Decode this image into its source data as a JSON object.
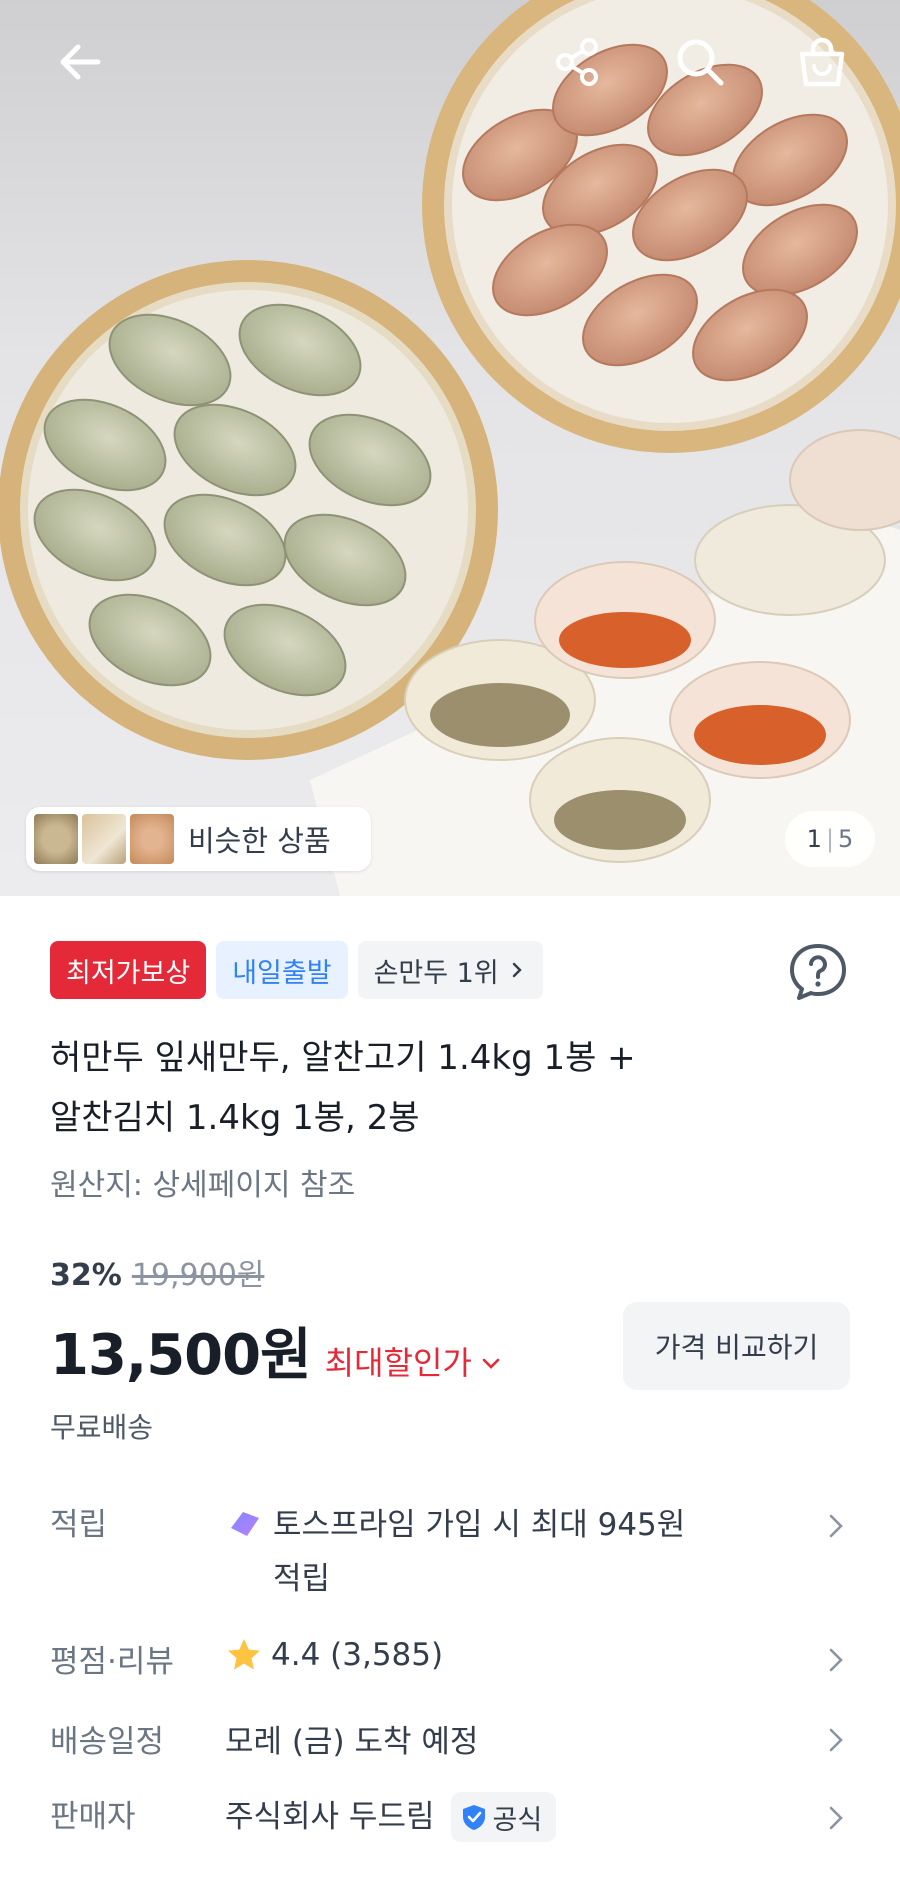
{
  "hero": {
    "similar_label": "비슷한 상품",
    "pager_current": "1",
    "pager_total": "5"
  },
  "topbar": {
    "back_icon": "arrow-left-icon",
    "share_icon": "share-icon",
    "search_icon": "search-icon",
    "cart_icon": "shopping-bag-icon"
  },
  "badges": {
    "lowest_price": "최저가보상",
    "tomorrow": "내일출발",
    "rank": "손만두 1위"
  },
  "product": {
    "title_line1": "허만두 잎새만두, 알찬고기 1.4kg 1봉 +",
    "title_line2": "알찬김치 1.4kg 1봉, 2봉",
    "origin": "원산지: 상세페이지 참조"
  },
  "price": {
    "discount": "32%",
    "original": "19,900원",
    "current": "13,500원",
    "max_discount": "최대할인가",
    "compare": "가격 비교하기",
    "shipping": "무료배송"
  },
  "info": {
    "points_key": "적립",
    "points_line1": "토스프라임 가입 시 최대 945원",
    "points_line2": "적립",
    "rating_key": "평점·리뷰",
    "rating_value": "4.4 (3,585)",
    "delivery_key": "배송일정",
    "delivery_value": "모레 (금) 도착 예정",
    "seller_key": "판매자",
    "seller_value": "주식회사 두드림",
    "official": "공식"
  },
  "colors": {
    "red": "#e42939",
    "blue": "#3182f6",
    "star": "#ffc342"
  }
}
